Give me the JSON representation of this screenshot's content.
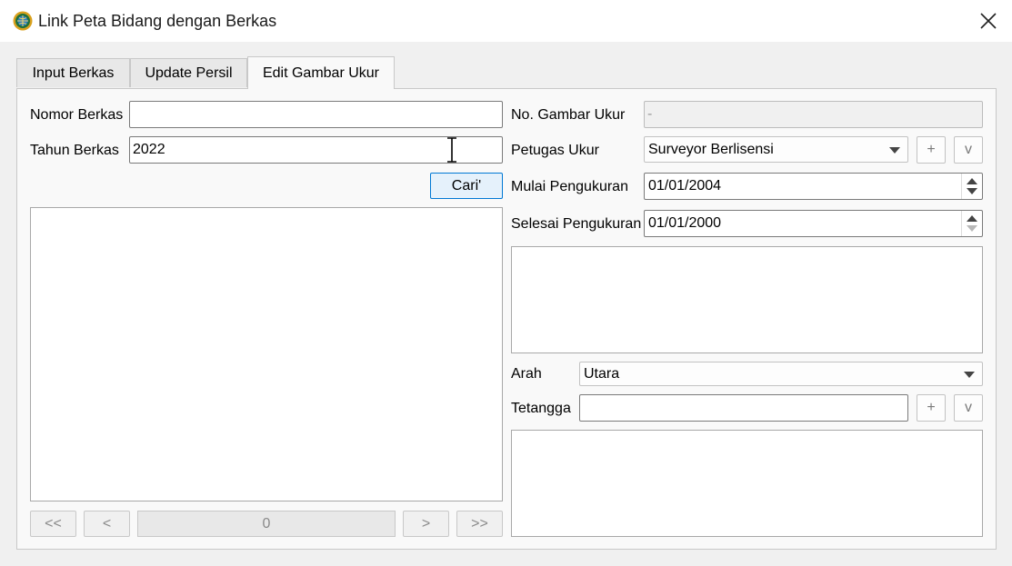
{
  "window": {
    "title": "Link Peta Bidang dengan Berkas",
    "icon": "bpn-logo-icon",
    "close_icon": "close-icon"
  },
  "tabs": [
    {
      "label": "Input Berkas",
      "active": false
    },
    {
      "label": "Update Persil",
      "active": false
    },
    {
      "label": "Edit Gambar Ukur",
      "active": true
    }
  ],
  "left": {
    "nomor_berkas": {
      "label": "Nomor Berkas",
      "value": ""
    },
    "tahun_berkas": {
      "label": "Tahun Berkas",
      "value": "2022"
    },
    "search_button": "Cari'",
    "pager": {
      "first": "<<",
      "prev": "<",
      "page": "0",
      "next": ">",
      "last": ">>"
    }
  },
  "right": {
    "no_gambar_ukur": {
      "label": "No. Gambar Ukur",
      "value": "-"
    },
    "petugas_ukur": {
      "label": "Petugas Ukur",
      "value": "Surveyor Berlisensi",
      "add": "+",
      "more": "v"
    },
    "mulai_pengukuran": {
      "label": "Mulai Pengukuran",
      "value": "01/01/2004"
    },
    "selesai_pengukuran": {
      "label": "Selesai Pengukuran",
      "value": "01/01/2000"
    },
    "arah": {
      "label": "Arah",
      "value": "Utara"
    },
    "tetangga": {
      "label": "Tetangga",
      "value": "",
      "add": "+",
      "more": "v"
    }
  }
}
